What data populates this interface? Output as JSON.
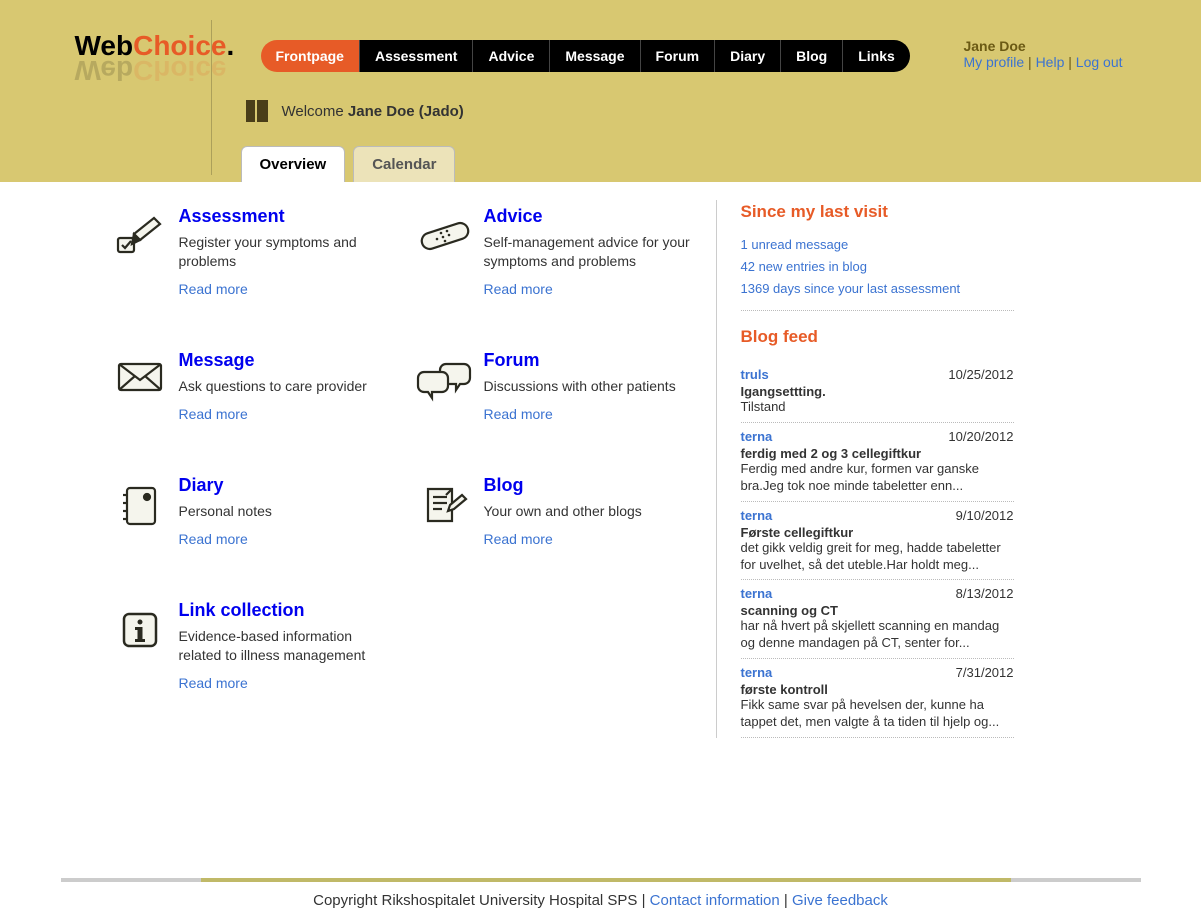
{
  "brand": {
    "part1": "Web",
    "part2": "Choice",
    "dot": "."
  },
  "nav": {
    "items": [
      {
        "label": "Frontpage"
      },
      {
        "label": "Assessment"
      },
      {
        "label": "Advice"
      },
      {
        "label": "Message"
      },
      {
        "label": "Forum"
      },
      {
        "label": "Diary"
      },
      {
        "label": "Blog"
      },
      {
        "label": "Links"
      }
    ]
  },
  "user": {
    "name": "Jane Doe",
    "profile": "My profile",
    "help": "Help",
    "logout": "Log out"
  },
  "welcome": {
    "prefix": "Welcome ",
    "boldname": "Jane Doe (Jado)"
  },
  "subtabs": {
    "overview": "Overview",
    "calendar": "Calendar"
  },
  "cards": [
    {
      "title": "Assessment",
      "desc": "Register your symptoms and problems",
      "read": "Read more"
    },
    {
      "title": "Advice",
      "desc": "Self-management advice for your symptoms and problems",
      "read": "Read more"
    },
    {
      "title": "Message",
      "desc": "Ask questions to care provider",
      "read": "Read more"
    },
    {
      "title": "Forum",
      "desc": "Discussions with other patients",
      "read": "Read more"
    },
    {
      "title": "Diary",
      "desc": "Personal notes",
      "read": "Read more"
    },
    {
      "title": "Blog",
      "desc": "Your own and other blogs",
      "read": "Read more"
    },
    {
      "title": "Link collection",
      "desc": "Evidence-based information related to illness management",
      "read": "Read more"
    }
  ],
  "since": {
    "heading": "Since my last visit",
    "items": [
      "1 unread message",
      "42 new entries in blog",
      "1369 days since your last assessment"
    ]
  },
  "feed": {
    "heading": "Blog feed",
    "items": [
      {
        "author": "truls",
        "date": "10/25/2012",
        "title": "Igangsettting.",
        "excerpt": "Tilstand"
      },
      {
        "author": "terna",
        "date": "10/20/2012",
        "title": "ferdig med 2 og 3 cellegiftkur",
        "excerpt": "Ferdig med andre kur, formen var ganske bra.Jeg tok noe minde tabeletter enn..."
      },
      {
        "author": "terna",
        "date": "9/10/2012",
        "title": "Første cellegiftkur",
        "excerpt": "det gikk veldig greit for meg, hadde tabeletter for uvelhet, så det uteble.Har holdt meg..."
      },
      {
        "author": "terna",
        "date": "8/13/2012",
        "title": "scanning og CT",
        "excerpt": "har nå hvert på skjellett scanning en mandag og denne mandagen på CT, senter for..."
      },
      {
        "author": "terna",
        "date": "7/31/2012",
        "title": "første kontroll",
        "excerpt": "Fikk same svar på hevelsen der, kunne ha tappet det, men valgte å ta tiden til hjelp og..."
      }
    ]
  },
  "footer": {
    "copy": "Copyright Rikshospitalet University Hospital SPS | ",
    "contact": "Contact information",
    "sep": " | ",
    "feedback": "Give feedback"
  }
}
